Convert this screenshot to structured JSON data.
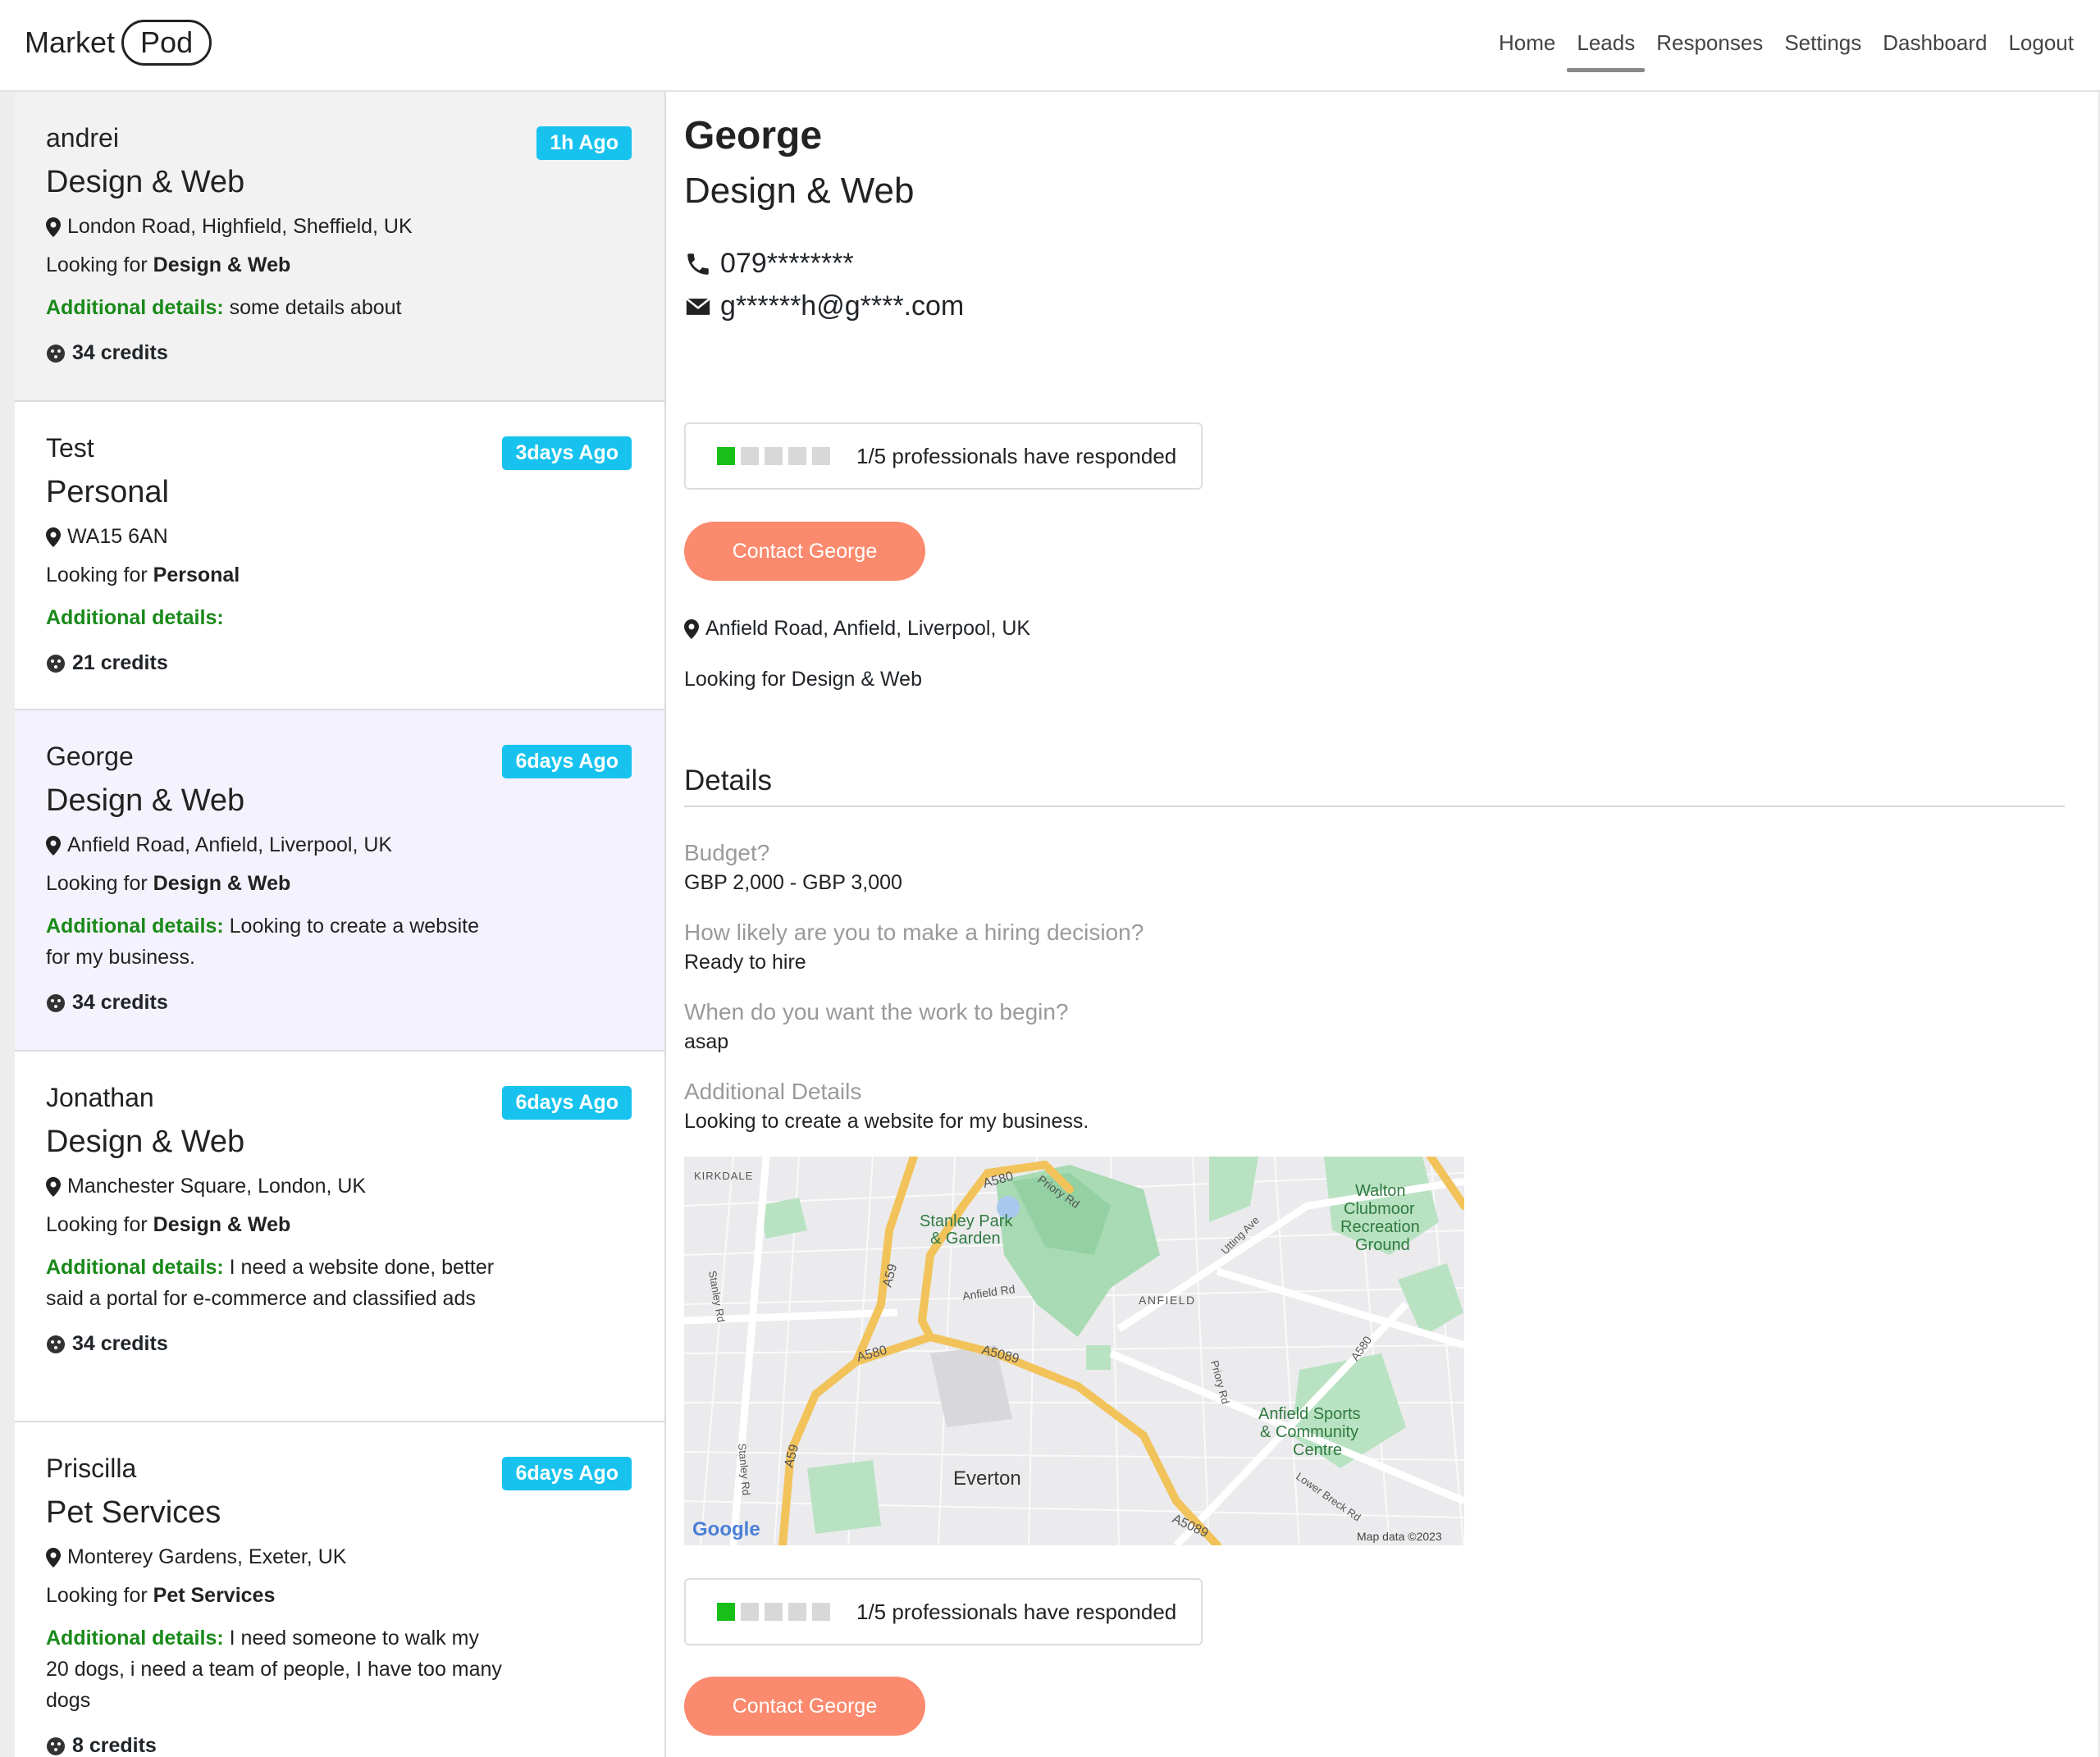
{
  "header": {
    "logo_left": "Market",
    "logo_right": "Pod",
    "nav": [
      "Home",
      "Leads",
      "Responses",
      "Settings",
      "Dashboard",
      "Logout"
    ],
    "active_nav": "Leads"
  },
  "leads": [
    {
      "name": "andrei",
      "category": "Design & Web",
      "badge": "1h Ago",
      "location": "London Road, Highfield, Sheffield, UK",
      "looking_prefix": "Looking for ",
      "looking": "Design & Web",
      "details_label": "Additional details:",
      "details": " some details about",
      "credits": "34 credits"
    },
    {
      "name": "Test",
      "category": "Personal",
      "badge": "3days Ago",
      "location": "WA15 6AN",
      "looking_prefix": "Looking for ",
      "looking": "Personal",
      "details_label": "Additional details:",
      "details": "",
      "credits": "21 credits"
    },
    {
      "name": "George",
      "category": "Design & Web",
      "badge": "6days Ago",
      "location": "Anfield Road, Anfield, Liverpool, UK",
      "looking_prefix": "Looking for ",
      "looking": "Design & Web",
      "details_label": "Additional details:",
      "details": " Looking to create a website for my business.",
      "credits": "34 credits"
    },
    {
      "name": "Jonathan",
      "category": "Design & Web",
      "badge": "6days Ago",
      "location": "Manchester Square, London, UK",
      "looking_prefix": "Looking for ",
      "looking": "Design & Web",
      "details_label": "Additional details:",
      "details": " I need a website done, better said a portal for e-commerce and classified ads",
      "credits": "34 credits"
    },
    {
      "name": "Priscilla",
      "category": "Pet Services",
      "badge": "6days Ago",
      "location": "Monterey Gardens, Exeter, UK",
      "looking_prefix": "Looking for ",
      "looking": "Pet Services",
      "details_label": "Additional details:",
      "details": " I need someone to walk my 20 dogs, i need a team of people, I have too many dogs",
      "credits": "8 credits"
    }
  ],
  "detail": {
    "name": "George",
    "category": "Design & Web",
    "phone": "079********",
    "email": "g******h@g****.com",
    "responded_text": "1/5 professionals have responded",
    "responded_count": 1,
    "responded_total": 5,
    "contact_label": "Contact George",
    "location": "Anfield Road, Anfield, Liverpool, UK",
    "looking": "Looking for Design & Web",
    "details_heading": "Details",
    "qa": [
      {
        "q": "Budget?",
        "a": "GBP 2,000 - GBP 3,000"
      },
      {
        "q": "How likely are you to make a hiring decision?",
        "a": "Ready to hire"
      },
      {
        "q": "When do you want the work to begin?",
        "a": "asap"
      },
      {
        "q": "Additional Details",
        "a": "Looking to create a website for my business."
      }
    ]
  },
  "map": {
    "labels": {
      "kirkdale": "KIRKDALE",
      "stanley_park_1": "Stanley Park",
      "stanley_park_2": "& Garden",
      "a580_top": "A580",
      "priory_rd_top": "Priory Rd",
      "a59_top": "A59",
      "anfield_rd": "Anfield Rd",
      "anfield": "ANFIELD",
      "utting_ave": "Utting Ave",
      "walton_1": "Walton",
      "walton_2": "Clubmoor",
      "walton_3": "Recreation",
      "walton_4": "Ground",
      "stanley_rd_top": "Stanley Rd",
      "a580_mid": "A580",
      "a5089_mid": "A5089",
      "a580_right": "A580",
      "priory_rd_mid": "Priory Rd",
      "a59_bottom": "A59",
      "anfield_sports_1": "Anfield Sports",
      "anfield_sports_2": "& Community",
      "anfield_sports_3": "Centre",
      "stanley_rd_bottom": "Stanley Rd",
      "everton": "Everton",
      "lower_breck": "Lower Breck Rd",
      "a5089_bottom": "A5089",
      "google": "Google",
      "map_data": "Map data ©2023"
    }
  }
}
